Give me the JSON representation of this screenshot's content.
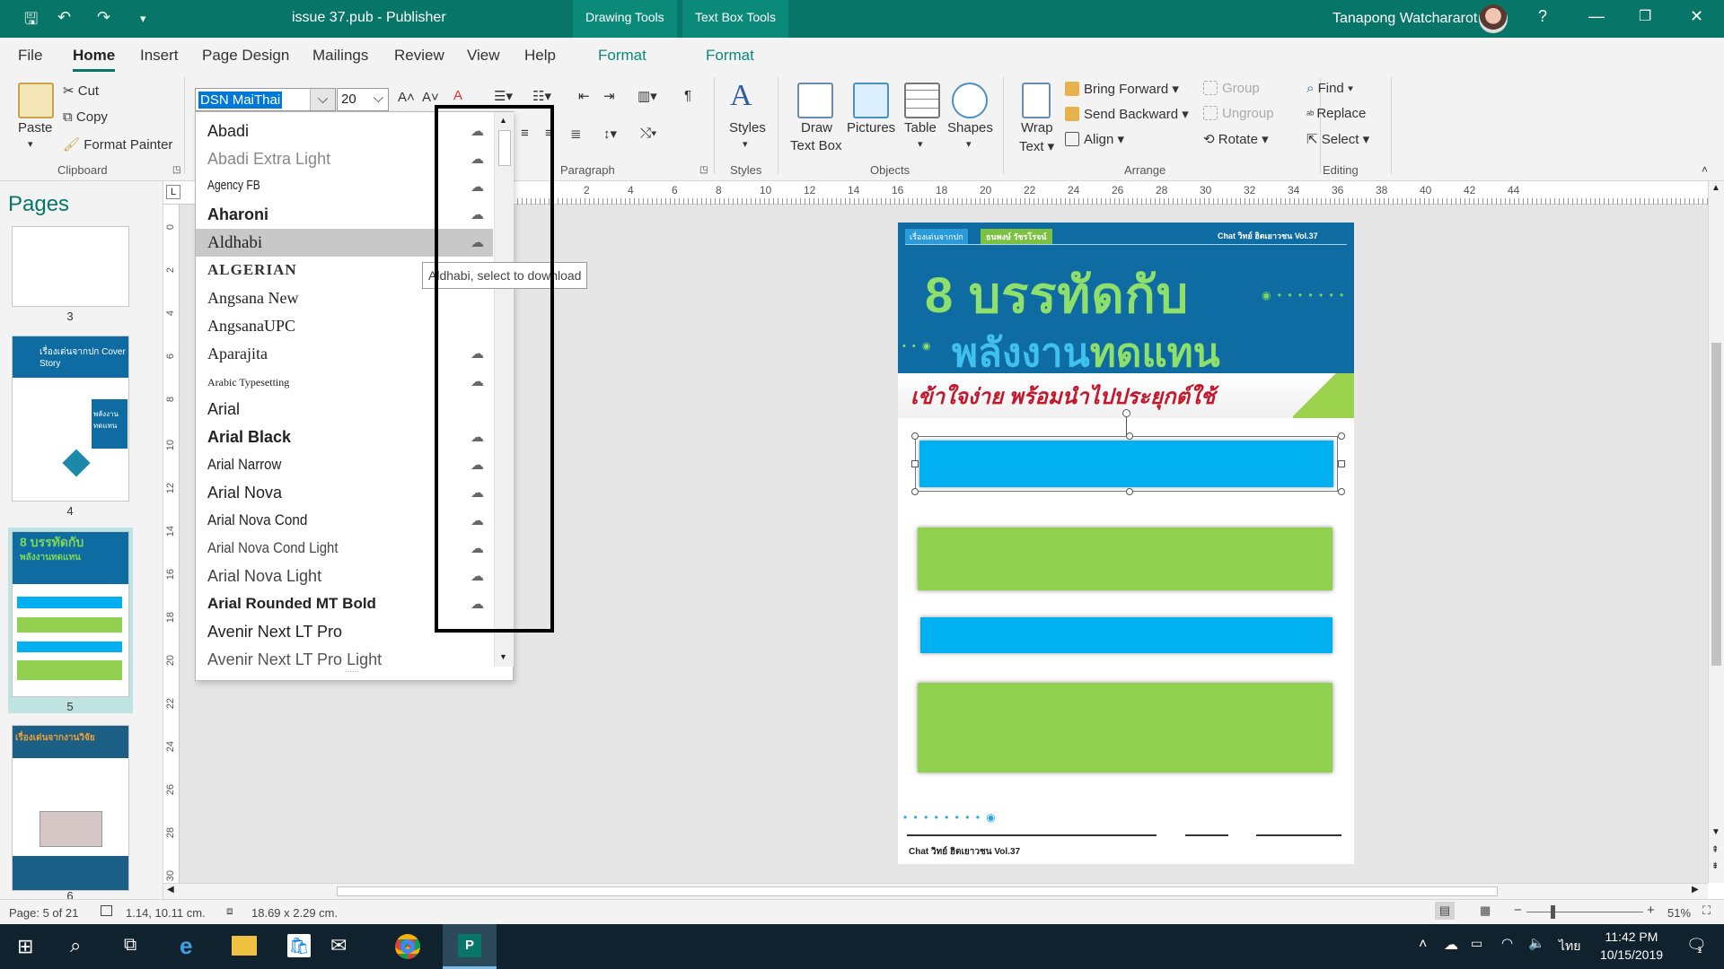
{
  "window": {
    "title": "issue 37.pub  -  Publisher",
    "context_tabs": [
      "Drawing Tools",
      "Text Box Tools"
    ],
    "user": "Tanapong Watchararot",
    "help": "?",
    "min": "—",
    "restore": "❐",
    "close": "✕"
  },
  "tabs": [
    "File",
    "Home",
    "Insert",
    "Page Design",
    "Mailings",
    "Review",
    "View",
    "Help",
    "Format",
    "Format"
  ],
  "ribbon": {
    "clipboard": {
      "paste": "Paste",
      "cut": "Cut",
      "copy": "Copy",
      "format_painter": "Format Painter",
      "label": "Clipboard"
    },
    "font": {
      "name": "DSN MaiThai",
      "size": "20"
    },
    "paragraph": {
      "label": "Paragraph"
    },
    "styles": {
      "btn": "Styles",
      "label": "Styles"
    },
    "objects": {
      "draw_text_box_1": "Draw",
      "draw_text_box_2": "Text Box",
      "pictures": "Pictures",
      "table": "Table",
      "shapes": "Shapes",
      "label": "Objects"
    },
    "arrange": {
      "wrap_1": "Wrap",
      "wrap_2": "Text ▾",
      "bring_forward": "Bring Forward",
      "send_backward": "Send Backward",
      "align": "Align ▾",
      "group": "Group",
      "ungroup": "Ungroup",
      "rotate": "Rotate ▾",
      "label": "Arrange"
    },
    "editing": {
      "find": "Find",
      "replace": "Replace",
      "select": "Select ▾",
      "label": "Editing"
    }
  },
  "pages_pane": {
    "title": "Pages",
    "numbers": [
      "3",
      "4",
      "5",
      "6"
    ]
  },
  "font_list": {
    "items": [
      {
        "name": "Abadi",
        "cloud": true
      },
      {
        "name": "Abadi Extra Light",
        "cloud": true
      },
      {
        "name": "Agency FB",
        "cloud": true
      },
      {
        "name": "Aharoni",
        "cloud": true
      },
      {
        "name": "Aldhabi",
        "cloud": true
      },
      {
        "name": "ALGERIAN",
        "cloud": false
      },
      {
        "name": "Angsana New",
        "cloud": false
      },
      {
        "name": "AngsanaUPC",
        "cloud": false
      },
      {
        "name": "Aparajita",
        "cloud": true
      },
      {
        "name": "Arabic Typesetting",
        "cloud": true
      },
      {
        "name": "Arial",
        "cloud": false
      },
      {
        "name": "Arial Black",
        "cloud": true
      },
      {
        "name": "Arial Narrow",
        "cloud": true
      },
      {
        "name": "Arial Nova",
        "cloud": true
      },
      {
        "name": "Arial Nova Cond",
        "cloud": true
      },
      {
        "name": "Arial Nova Cond Light",
        "cloud": true
      },
      {
        "name": "Arial Nova Light",
        "cloud": true
      },
      {
        "name": "Arial Rounded MT Bold",
        "cloud": true
      },
      {
        "name": "Avenir Next LT Pro",
        "cloud": false
      },
      {
        "name": "Avenir Next LT Pro Light",
        "cloud": false
      }
    ],
    "highlighted": "Aldhabi",
    "tooltip": "Aldhabi, select to download"
  },
  "ruler": {
    "h_labels": [
      "2",
      "4",
      "6",
      "8",
      "10",
      "12",
      "14",
      "16",
      "18",
      "20",
      "22",
      "24",
      "26",
      "28",
      "30",
      "32",
      "34",
      "36",
      "38",
      "40",
      "42",
      "44",
      "2",
      "4",
      "6",
      "8",
      "10",
      "12",
      "14",
      "16",
      "18",
      "20",
      "22",
      "24",
      "26",
      "28",
      "30",
      "32",
      "34",
      "36",
      "38",
      "40",
      "42",
      "44"
    ],
    "v_labels": [
      "0",
      "2",
      "4",
      "6",
      "8",
      "10",
      "12",
      "14",
      "16",
      "18",
      "20",
      "22",
      "24",
      "26",
      "28",
      "30"
    ]
  },
  "page_content": {
    "tag_left": "เรื่องเด่นจากปก",
    "tag_name": "ธนพงษ์ วัชรโรจน์",
    "header_right": "Chat วิทย์ ฮิตเยาวชน Vol.37",
    "headline_1": "8 บรรทัดกับ",
    "headline_2a": "พลังงาน",
    "headline_2b": "ทดแทน",
    "subhead": "เข้าใจง่าย พร้อมนำไปประยุกต์ใช้",
    "footer": "Chat วิทย์ ฮิตเยาวชน Vol.37",
    "thumb4_title": "เรื่องเด่นจากปก Cover Story",
    "thumb4_side": "พลังงาน ทดแทน",
    "thumb5_title": "8 บรรทัดกับ",
    "thumb5_sub": "พลังงานทดแทน",
    "thumb6_title": "เรื่องเด่นจากงานวิจัย"
  },
  "status": {
    "page": "Page: 5 of 21",
    "position": "1.14, 10.11 cm.",
    "size": "18.69 x   2.29 cm.",
    "zoom": "51%"
  },
  "taskbar": {
    "lang": "ไทย",
    "time": "11:42 PM",
    "date": "10/15/2019",
    "notif": "1"
  },
  "colors": {
    "brand": "#077568",
    "cyan_box": "#00b0f0",
    "green_box": "#92d050",
    "banner": "#0f6ca2"
  }
}
